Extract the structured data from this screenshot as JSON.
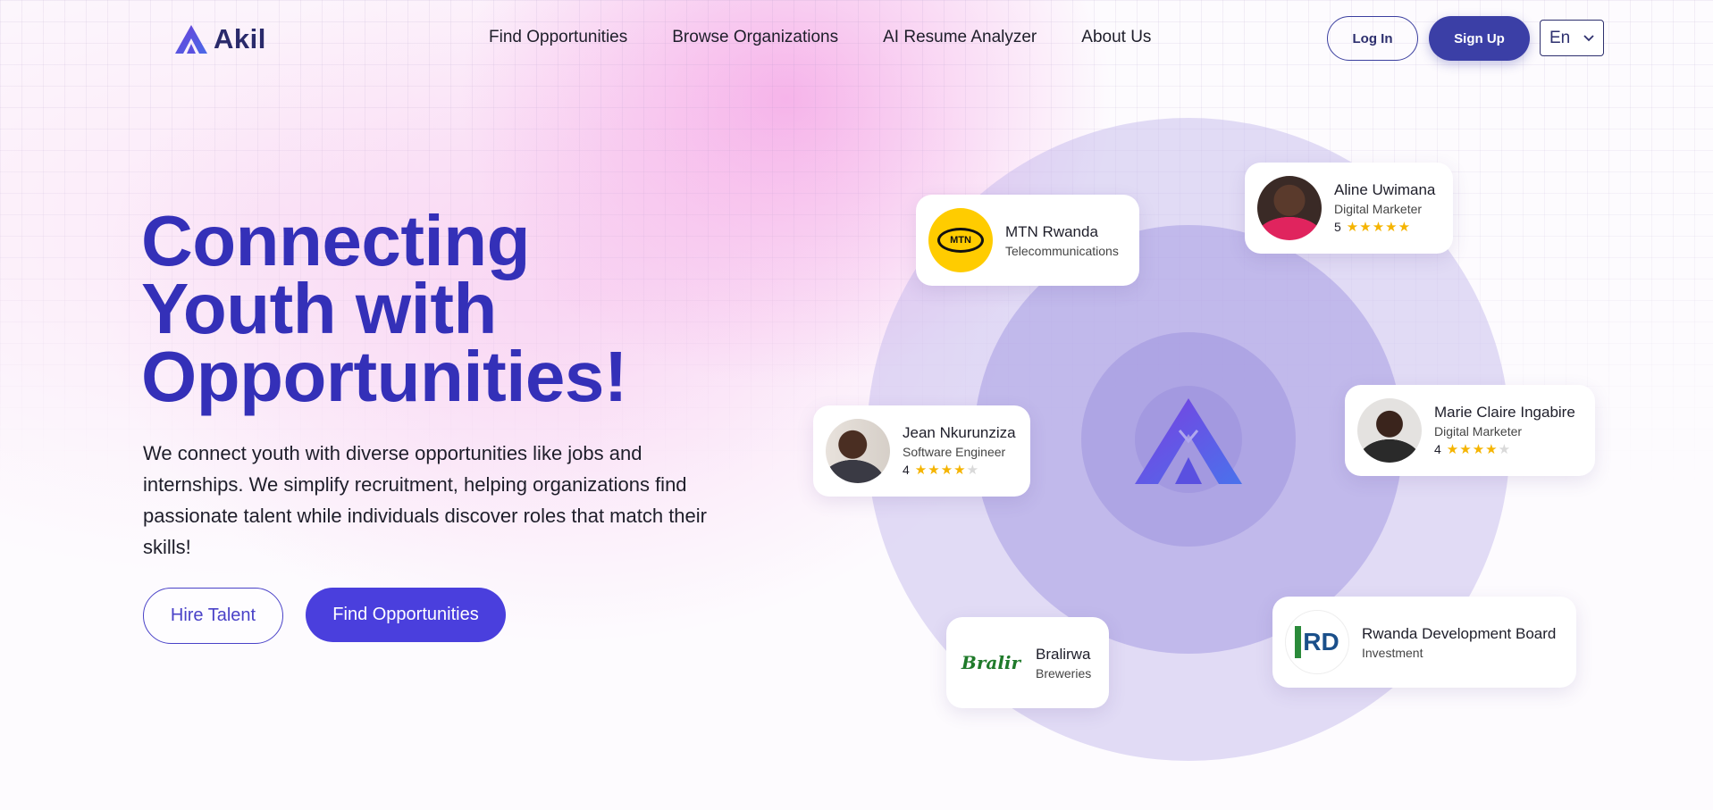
{
  "brand": {
    "name": "Akil"
  },
  "nav": {
    "items": [
      {
        "label": "Find Opportunities"
      },
      {
        "label": "Browse Organizations"
      },
      {
        "label": "AI Resume Analyzer"
      },
      {
        "label": "About Us"
      }
    ]
  },
  "auth": {
    "login_label": "Log In",
    "signup_label": "Sign Up"
  },
  "language": {
    "selected": "En"
  },
  "hero": {
    "headline_lines": [
      "Connecting",
      "Youth with",
      "Opportunities!"
    ],
    "description": "We connect youth with diverse opportunities like jobs and internships. We simplify recruitment, helping organizations find passionate talent while individuals discover roles that match their skills!",
    "hire_label": "Hire Talent",
    "find_label": "Find Opportunities"
  },
  "organizations": [
    {
      "name": "MTN Rwanda",
      "category": "Telecommunications",
      "logo_text": "MTN"
    },
    {
      "name": "Bralirwa",
      "category": "Breweries",
      "logo_text": "Bralir"
    },
    {
      "name": "Rwanda Development Board",
      "category": "Investment",
      "logo_text": "RD"
    }
  ],
  "talents": [
    {
      "name": "Aline Uwimana",
      "role": "Digital Marketer",
      "rating": "5",
      "stars": 5
    },
    {
      "name": "Jean Nkurunziza",
      "role": "Software Engineer",
      "rating": "4",
      "stars": 4
    },
    {
      "name": "Marie Claire Ingabire",
      "role": "Digital Marketer",
      "rating": "4",
      "stars": 4
    }
  ],
  "colors": {
    "primary": "#3430b8",
    "button": "#4a3fdd",
    "signup": "#3b3fa6",
    "star": "#f5b400",
    "mtn_yellow": "#ffcc00"
  }
}
